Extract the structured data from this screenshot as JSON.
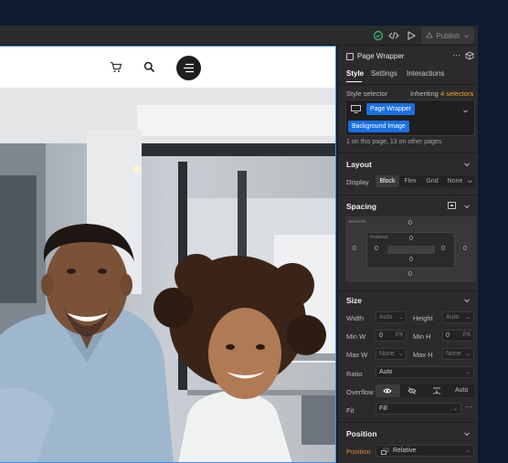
{
  "toolbar": {
    "publish_label": "Publish"
  },
  "panel": {
    "element_title": "Page Wrapper",
    "tabs": [
      "Style",
      "Settings",
      "Interactions"
    ],
    "style_selector": {
      "label": "Style selector",
      "inheriting_prefix": "Inheriting",
      "inheriting_count": "4 selectors",
      "selector_tags": [
        "Page Wrapper",
        "Background Image"
      ],
      "usage_note": "1 on this page, 13 on other pages."
    },
    "layout": {
      "title": "Layout",
      "display_label": "Display",
      "display_options": [
        "Block",
        "Flex",
        "Grid",
        "None"
      ]
    },
    "spacing": {
      "title": "Spacing",
      "margin_label": "MARGIN",
      "padding_label": "PADDING",
      "margin": {
        "top": "0",
        "right": "0",
        "bottom": "0",
        "left": "0"
      },
      "padding": {
        "top": "0",
        "right": "0",
        "bottom": "0",
        "left": "0"
      }
    },
    "size": {
      "title": "Size",
      "width_label": "Width",
      "width_value": "Auto",
      "height_label": "Height",
      "height_value": "Auto",
      "min_w_label": "Min W",
      "min_w_value": "0",
      "min_w_unit": "PX",
      "min_h_label": "Min H",
      "min_h_value": "0",
      "min_h_unit": "PX",
      "max_w_label": "Max W",
      "max_w_value": "None",
      "max_h_label": "Max H",
      "max_h_value": "None",
      "ratio_label": "Ratio",
      "ratio_value": "Auto",
      "overflow_label": "Overflow",
      "overflow_auto": "Auto",
      "fit_label": "Fit",
      "fit_value": "Fill"
    },
    "position": {
      "title": "Position",
      "position_label": "Position",
      "position_value": "Relative"
    }
  },
  "colors": {
    "accent": "#1a6fe0",
    "inherit_highlight": "#f5a623",
    "position_label": "#e8803a",
    "status_green": "#2fb36b"
  }
}
